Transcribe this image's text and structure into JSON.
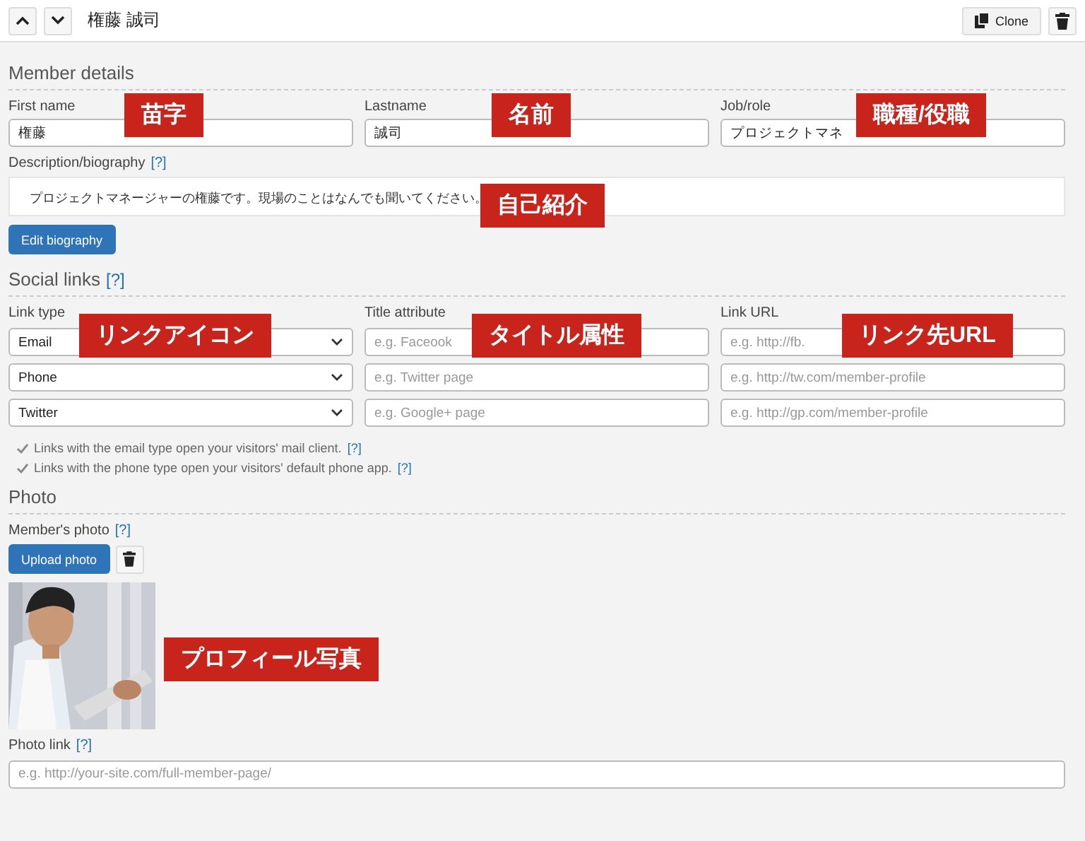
{
  "header": {
    "title": "権藤 誠司",
    "clone_label": "Clone"
  },
  "member_details": {
    "heading": "Member details",
    "fields": [
      {
        "label": "First name",
        "value": "権藤"
      },
      {
        "label": "Lastname",
        "value": "誠司"
      },
      {
        "label": "Job/role",
        "value": "プロジェクトマネ"
      }
    ],
    "bio_label": "Description/biography",
    "bio_help": "[?]",
    "bio_text": "プロジェクトマネージャーの権藤です。現場のことはなんでも聞いてください。",
    "edit_button": "Edit biography"
  },
  "social_links": {
    "heading": "Social links",
    "help": "[?]",
    "columns": [
      "Link type",
      "Title attribute",
      "Link URL"
    ],
    "rows": [
      {
        "type": "Email",
        "title_placeholder": "e.g. Faceook",
        "url_placeholder": "e.g. http://fb."
      },
      {
        "type": "Phone",
        "title_placeholder": "e.g. Twitter page",
        "url_placeholder": "e.g. http://tw.com/member-profile"
      },
      {
        "type": "Twitter",
        "title_placeholder": "e.g. Google+ page",
        "url_placeholder": "e.g. http://gp.com/member-profile"
      }
    ],
    "notes": [
      {
        "text": "Links with the email type open your visitors' mail client.",
        "help": "[?]"
      },
      {
        "text": "Links with the phone type open your visitors' default phone app.",
        "help": "[?]"
      }
    ]
  },
  "photo": {
    "heading": "Photo",
    "label": "Member's photo",
    "help": "[?]",
    "upload_button": "Upload photo",
    "link_label": "Photo link",
    "link_help": "[?]",
    "link_placeholder": "e.g. http://your-site.com/full-member-page/"
  },
  "annotations": [
    "苗字",
    "名前",
    "職種/役職",
    "自己紹介",
    "リンクアイコン",
    "タイトル属性",
    "リンク先URL",
    "プロフィール写真"
  ]
}
